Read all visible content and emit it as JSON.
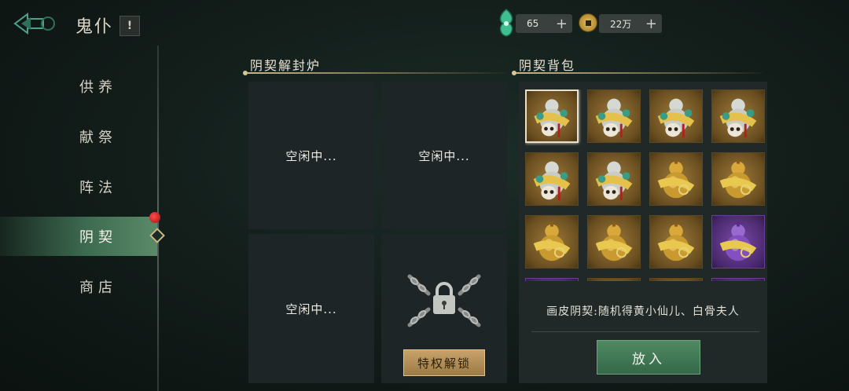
{
  "header": {
    "title": "鬼仆",
    "info_icon": "exclamation-icon",
    "back_icon": "back-arrow-icon"
  },
  "currencies": {
    "jade": {
      "icon": "jade-icon",
      "value": "65",
      "add": "+"
    },
    "coin": {
      "icon": "coin-icon",
      "value": "22万",
      "add": "+"
    }
  },
  "sidebar": {
    "items": [
      {
        "label": "供养"
      },
      {
        "label": "献祭"
      },
      {
        "label": "阵法"
      },
      {
        "label": "阴契",
        "active": true,
        "badge": "red-dot"
      },
      {
        "label": "商店"
      }
    ]
  },
  "furnace": {
    "title": "阴契解封炉",
    "slots": [
      {
        "status": "空闲中..."
      },
      {
        "status": "空闲中..."
      },
      {
        "status": "空闲中..."
      },
      {
        "status": "locked",
        "icon": "chain-lock-icon"
      }
    ],
    "unlock_label": "特权解锁"
  },
  "bag": {
    "title": "阴契背包",
    "items": [
      {
        "kind": "gourd-skull",
        "rarity": "gold",
        "selected": true
      },
      {
        "kind": "gourd-skull",
        "rarity": "gold"
      },
      {
        "kind": "gourd-skull",
        "rarity": "gold"
      },
      {
        "kind": "gourd-skull",
        "rarity": "gold"
      },
      {
        "kind": "gourd-skull",
        "rarity": "gold"
      },
      {
        "kind": "gourd-skull",
        "rarity": "gold"
      },
      {
        "kind": "gourd-gold",
        "rarity": "gold"
      },
      {
        "kind": "gourd-gold",
        "rarity": "gold"
      },
      {
        "kind": "gourd-gold",
        "rarity": "gold"
      },
      {
        "kind": "gourd-gold",
        "rarity": "gold"
      },
      {
        "kind": "gourd-gold",
        "rarity": "gold"
      },
      {
        "kind": "gourd-purple",
        "rarity": "purple"
      }
    ],
    "description": "画皮阴契:随机得黄小仙儿、白骨夫人",
    "put_label": "放入"
  },
  "colors": {
    "accent_green": "#3d6b50",
    "gold": "#c9a26a",
    "purple": "#6a3f96"
  }
}
